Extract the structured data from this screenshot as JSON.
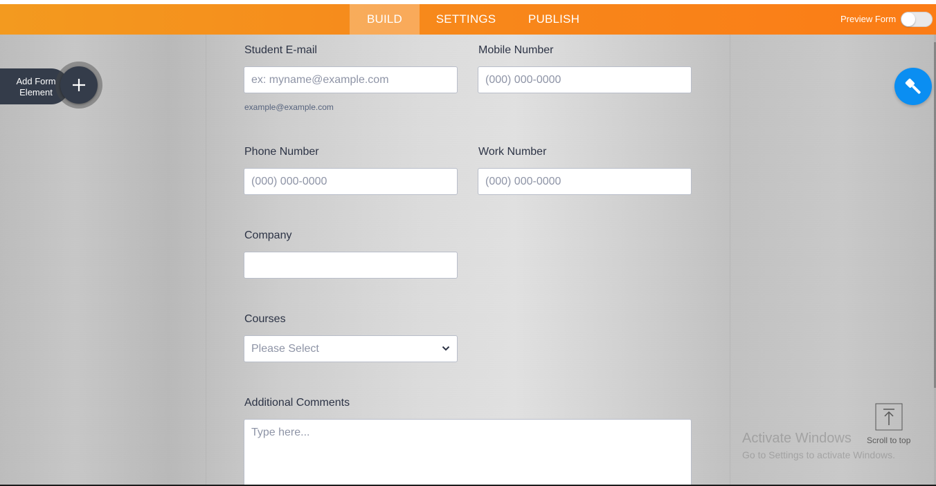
{
  "tabs": [
    {
      "label": "BUILD",
      "active": true
    },
    {
      "label": "SETTINGS",
      "active": false
    },
    {
      "label": "PUBLISH",
      "active": false
    }
  ],
  "preview": {
    "label": "Preview Form",
    "on": false
  },
  "add_element": {
    "label": "Add Form Element",
    "plus": "+"
  },
  "fields": {
    "student_email": {
      "label": "Student E-mail",
      "placeholder": "ex: myname@example.com",
      "sublabel": "example@example.com"
    },
    "mobile": {
      "label": "Mobile Number",
      "placeholder": "(000) 000-0000"
    },
    "phone": {
      "label": "Phone Number",
      "placeholder": "(000) 000-0000"
    },
    "work": {
      "label": "Work Number",
      "placeholder": "(000) 000-0000"
    },
    "company": {
      "label": "Company",
      "placeholder": ""
    },
    "courses": {
      "label": "Courses",
      "selected": "Please Select"
    },
    "comments": {
      "label": "Additional Comments",
      "placeholder": "Type here..."
    }
  },
  "scroll_to_top": {
    "label": "Scroll to top"
  },
  "watermark": {
    "line1": "Activate Windows",
    "line2": "Go to Settings to activate Windows."
  },
  "icons": {
    "add": "plus-icon",
    "designer": "paint-brush-icon",
    "scroll": "arrow-up-icon",
    "select": "chevron-down-icon"
  },
  "colors": {
    "topbar": "#f7891b",
    "fab": "#0a8ef2",
    "add_button": "#343c4a",
    "label": "#2c3345"
  }
}
